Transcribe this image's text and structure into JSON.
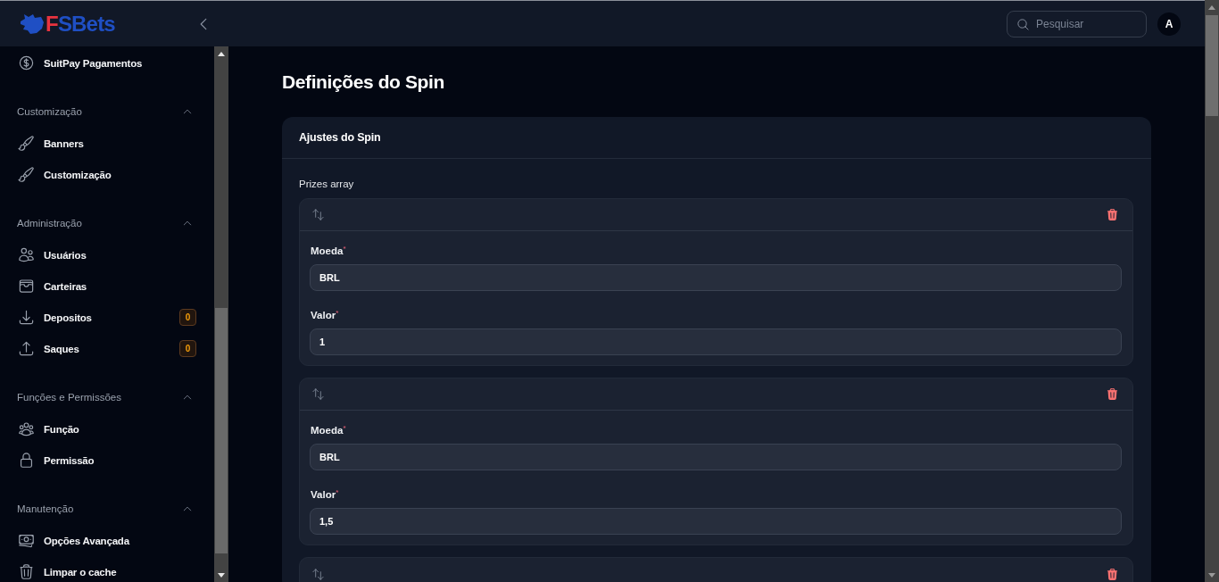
{
  "header": {
    "logo": [
      {
        "text": "F",
        "color": "#e8333f"
      },
      {
        "text": "SBets",
        "color": "#1f4fc4"
      }
    ],
    "search": {
      "placeholder": "Pesquisar"
    },
    "avatar": "A"
  },
  "sidebar": {
    "sections": [
      {
        "items": [
          {
            "label": "SuitPay Pagamentos"
          }
        ]
      },
      {
        "title": "Customização",
        "expanded": true,
        "items": [
          {
            "label": "Banners"
          },
          {
            "label": "Customização"
          }
        ]
      },
      {
        "title": "Administração",
        "expanded": true,
        "items": [
          {
            "label": "Usuários"
          },
          {
            "label": "Carteiras"
          },
          {
            "label": "Depositos",
            "badge": "0"
          },
          {
            "label": "Saques",
            "badge": "0"
          }
        ]
      },
      {
        "title": "Funções e Permissões",
        "expanded": true,
        "items": [
          {
            "label": "Função"
          },
          {
            "label": "Permissão"
          }
        ]
      },
      {
        "title": "Manutenção",
        "expanded": true,
        "items": [
          {
            "label": "Opções Avançada"
          },
          {
            "label": "Limpar o cache"
          }
        ]
      }
    ]
  },
  "page": {
    "title": "Definições do Spin",
    "card": {
      "title": "Ajustes do Spin",
      "field_label": "Prizes array",
      "prizes": [
        {
          "kind": "full",
          "fields": [
            {
              "label": "Moeda$^{*}$",
              "value": "BRL"
            },
            {
              "label": "Valor$^{*}$",
              "value": "1"
            }
          ]
        },
        {
          "kind": "full",
          "fields": [
            {
              "label": "Moeda$^{*}$",
              "value": "BRL"
            },
            {
              "label": "Valor$^{*}$",
              "value": "1,5"
            }
          ]
        },
        {
          "kind": "cut_off"
        }
      ]
    }
  }
}
